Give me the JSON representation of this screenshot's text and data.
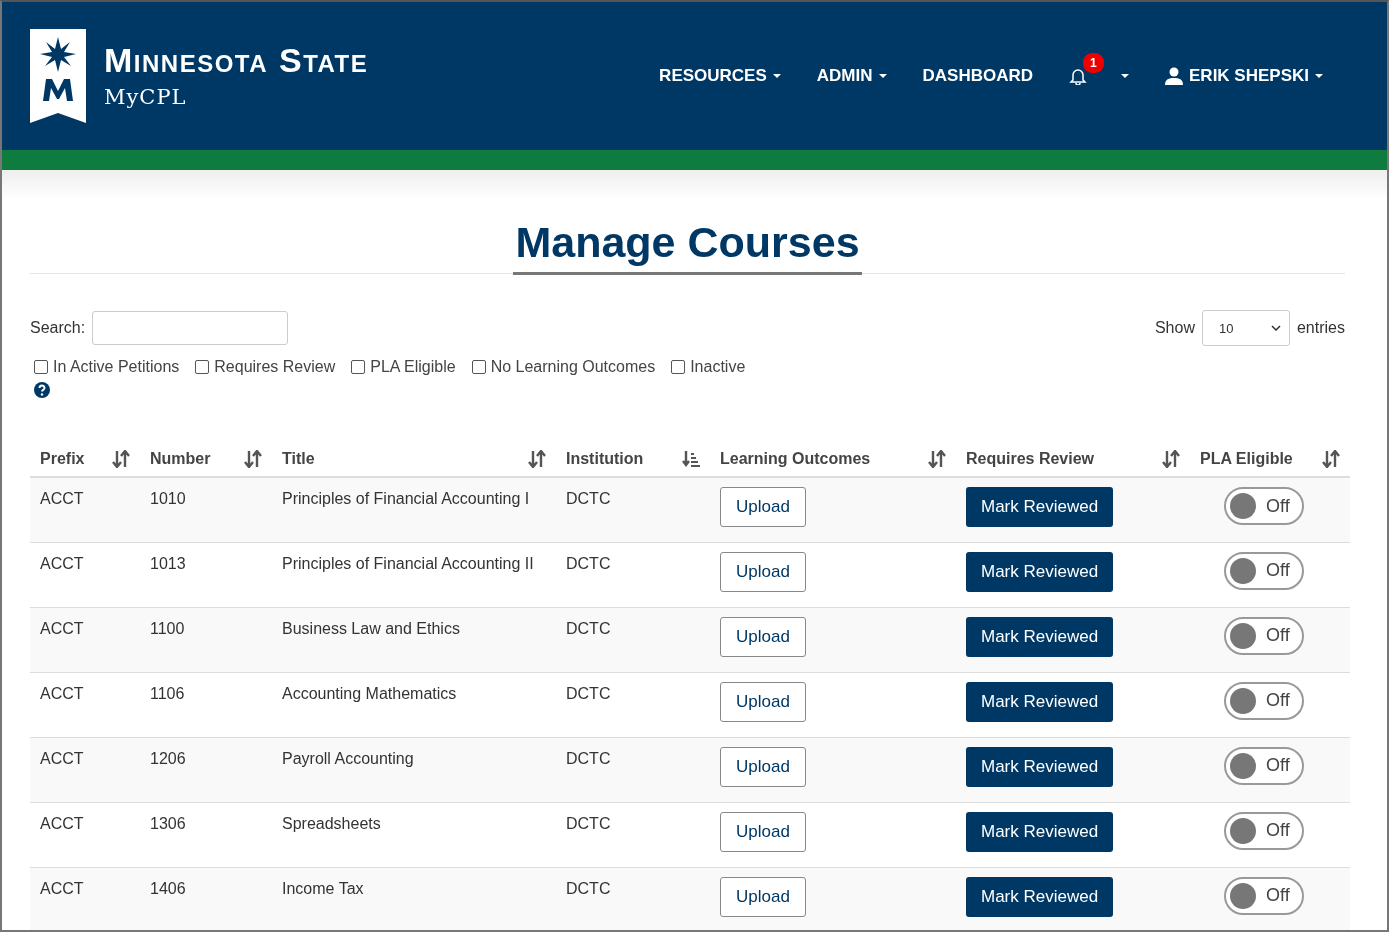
{
  "brand": {
    "name": "Minnesota State",
    "product": "MyCPL"
  },
  "nav": [
    {
      "label": "RESOURCES",
      "dropdown": true
    },
    {
      "label": "ADMIN",
      "dropdown": true
    },
    {
      "label": "DASHBOARD",
      "dropdown": false
    }
  ],
  "notifications": {
    "count": "1"
  },
  "user": {
    "name": "ERIK SHEPSKI"
  },
  "page_title": "Manage Courses",
  "search": {
    "label": "Search:"
  },
  "show": {
    "label": "Show",
    "value": "10",
    "suffix": "entries"
  },
  "filters": [
    {
      "label": "In Active Petitions",
      "checked": false
    },
    {
      "label": "Requires Review",
      "checked": false
    },
    {
      "label": "PLA Eligible",
      "checked": false
    },
    {
      "label": "No Learning Outcomes",
      "checked": false
    },
    {
      "label": "Inactive",
      "checked": false
    }
  ],
  "columns": [
    {
      "label": "Prefix",
      "sorted": false
    },
    {
      "label": "Number",
      "sorted": false
    },
    {
      "label": "Title",
      "sorted": false
    },
    {
      "label": "Institution",
      "sorted": true
    },
    {
      "label": "Learning Outcomes",
      "sorted": false
    },
    {
      "label": "Requires Review",
      "sorted": false
    },
    {
      "label": "PLA Eligible",
      "sorted": false
    }
  ],
  "rows": [
    {
      "prefix": "ACCT",
      "number": "1010",
      "title": "Principles of Financial Accounting I",
      "institution": "DCTC",
      "upload": "Upload",
      "review": "Mark Reviewed",
      "pla": {
        "on": false,
        "label": "Off"
      }
    },
    {
      "prefix": "ACCT",
      "number": "1013",
      "title": "Principles of Financial Accounting II",
      "institution": "DCTC",
      "upload": "Upload",
      "review": "Mark Reviewed",
      "pla": {
        "on": false,
        "label": "Off"
      }
    },
    {
      "prefix": "ACCT",
      "number": "1100",
      "title": "Business Law and Ethics",
      "institution": "DCTC",
      "upload": "Upload",
      "review": "Mark Reviewed",
      "pla": {
        "on": false,
        "label": "Off"
      }
    },
    {
      "prefix": "ACCT",
      "number": "1106",
      "title": "Accounting Mathematics",
      "institution": "DCTC",
      "upload": "Upload",
      "review": "Mark Reviewed",
      "pla": {
        "on": false,
        "label": "Off"
      }
    },
    {
      "prefix": "ACCT",
      "number": "1206",
      "title": "Payroll Accounting",
      "institution": "DCTC",
      "upload": "Upload",
      "review": "Mark Reviewed",
      "pla": {
        "on": false,
        "label": "Off"
      }
    },
    {
      "prefix": "ACCT",
      "number": "1306",
      "title": "Spreadsheets",
      "institution": "DCTC",
      "upload": "Upload",
      "review": "Mark Reviewed",
      "pla": {
        "on": false,
        "label": "Off"
      }
    },
    {
      "prefix": "ACCT",
      "number": "1406",
      "title": "Income Tax",
      "institution": "DCTC",
      "upload": "Upload",
      "review": "Mark Reviewed",
      "pla": {
        "on": false,
        "label": "Off"
      }
    }
  ]
}
